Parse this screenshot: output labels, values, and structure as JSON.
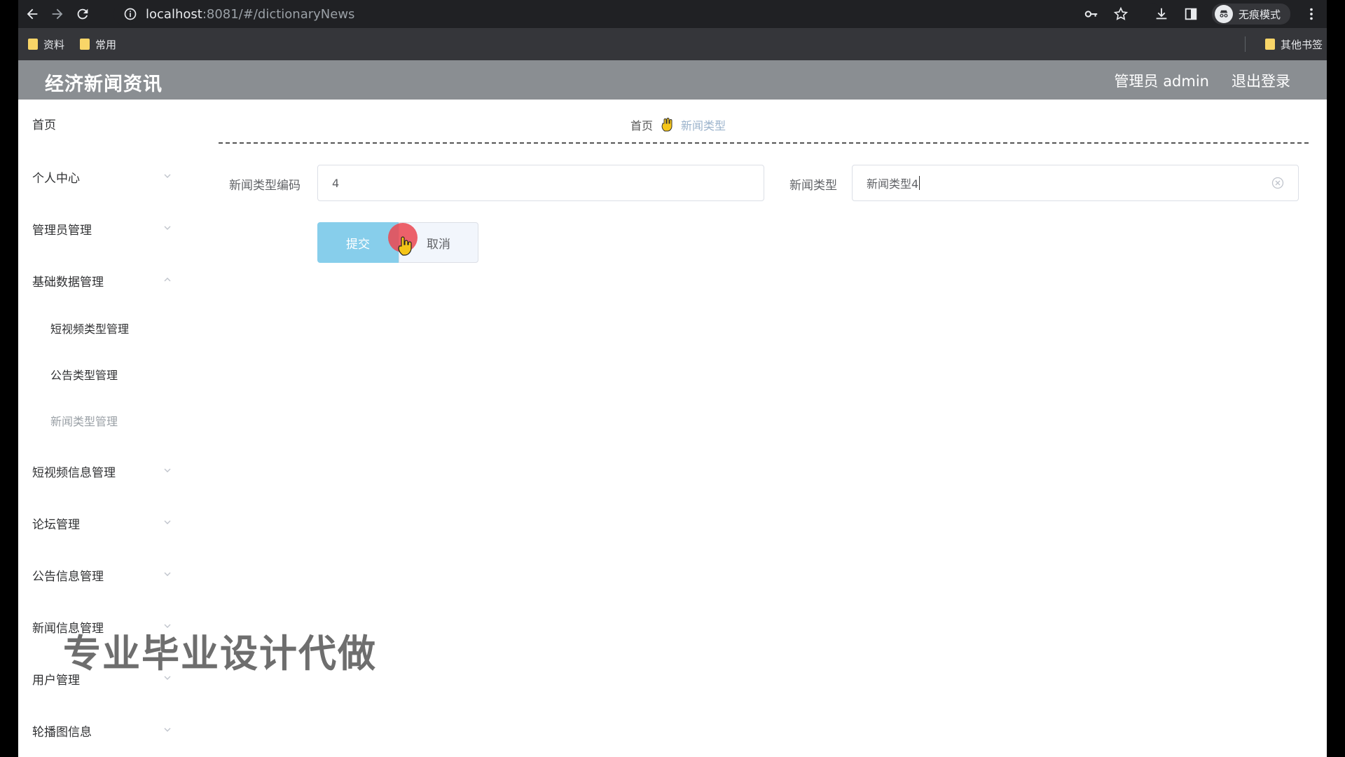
{
  "browser": {
    "url_host": "localhost",
    "url_path": ":8081/#/dictionaryNews",
    "incognito_label": "无痕模式",
    "bookmarks": [
      "资料",
      "常用"
    ],
    "other_bookmarks": "其他书签",
    "icons": [
      "back-arrow-icon",
      "forward-arrow-icon",
      "reload-icon",
      "info-icon",
      "key-icon",
      "star-icon",
      "download-icon",
      "sidepanel-icon",
      "incognito-icon",
      "more-vert-icon"
    ]
  },
  "header": {
    "title": "经济新闻资讯",
    "user": "管理员 admin",
    "logout": "退出登录",
    "background_color": "#8a8e92"
  },
  "sidebar": {
    "items": [
      {
        "label": "首页"
      },
      {
        "label": "个人中心"
      },
      {
        "label": "管理员管理"
      },
      {
        "label": "基础数据管理"
      },
      {
        "label": "短视频类型管理"
      },
      {
        "label": "公告类型管理"
      },
      {
        "label": "新闻类型管理"
      },
      {
        "label": "短视频信息管理"
      },
      {
        "label": "论坛管理"
      },
      {
        "label": "公告信息管理"
      },
      {
        "label": "新闻信息管理"
      },
      {
        "label": "用户管理"
      },
      {
        "label": "轮播图信息"
      }
    ]
  },
  "breadcrumb": {
    "home": "首页",
    "current": "新闻类型"
  },
  "form": {
    "code_label": "新闻类型编码",
    "code_value": "4",
    "type_label": "新闻类型",
    "type_value": "新闻类型4",
    "submit": "提交",
    "cancel": "取消",
    "submit_color": "#87ceeb"
  },
  "watermark": "专业毕业设计代做"
}
